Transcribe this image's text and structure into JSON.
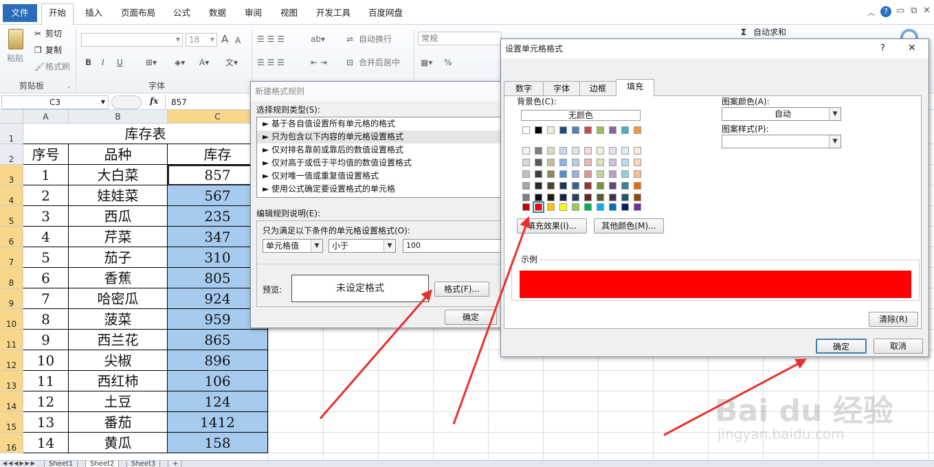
{
  "ribbon": {
    "tabs": [
      "文件",
      "开始",
      "插入",
      "页面布局",
      "公式",
      "数据",
      "审阅",
      "视图",
      "开发工具",
      "百度网盘"
    ],
    "clipboard": {
      "paste": "粘贴",
      "cut": "剪切",
      "copy": "复制",
      "format_painter": "格式刷",
      "group": "剪贴板"
    },
    "font": {
      "size": "18",
      "group": "字体",
      "grow": "A",
      "shrink": "A",
      "bold": "B",
      "italic": "I",
      "underline": "U"
    },
    "alignment": {
      "wrap": "自动换行",
      "merge": "合并后居中"
    },
    "number": {
      "format": "常规",
      "percent": "%"
    },
    "editing": {
      "autosum": "自动求和"
    }
  },
  "formula_bar": {
    "cell_ref": "C3",
    "fx": "fx",
    "value": "857"
  },
  "grid": {
    "columns": [
      "A",
      "B",
      "C"
    ],
    "title": "库存表",
    "headers": [
      "序号",
      "品种",
      "库存"
    ],
    "rows": [
      [
        "1",
        "大白菜",
        "857"
      ],
      [
        "2",
        "娃娃菜",
        "567"
      ],
      [
        "3",
        "西瓜",
        "235"
      ],
      [
        "4",
        "芹菜",
        "347"
      ],
      [
        "5",
        "茄子",
        "310"
      ],
      [
        "6",
        "香蕉",
        "805"
      ],
      [
        "7",
        "哈密瓜",
        "924"
      ],
      [
        "8",
        "菠菜",
        "959"
      ],
      [
        "9",
        "西兰花",
        "865"
      ],
      [
        "10",
        "尖椒",
        "896"
      ],
      [
        "11",
        "西红柿",
        "106"
      ],
      [
        "12",
        "土豆",
        "124"
      ],
      [
        "13",
        "番茄",
        "1412"
      ],
      [
        "14",
        "黄瓜",
        "158"
      ]
    ],
    "row_numbers": [
      "1",
      "2",
      "3",
      "4",
      "5",
      "6",
      "7",
      "8",
      "9",
      "10",
      "11",
      "12",
      "13",
      "14",
      "15",
      "16"
    ],
    "highlight_color": "#a6cbee"
  },
  "sheets": [
    "Sheet1",
    "Sheet2",
    "Sheet3"
  ],
  "rule_dialog": {
    "title": "新建格式规则",
    "select_type_label": "选择规则类型(S):",
    "rule_types": [
      "基于各自值设置所有单元格的格式",
      "只为包含以下内容的单元格设置格式",
      "仅对排名靠前或靠后的数值设置格式",
      "仅对高于或低于平均值的数值设置格式",
      "仅对唯一值或重复值设置格式",
      "使用公式确定要设置格式的单元格"
    ],
    "edit_label": "编辑规则说明(E):",
    "condition_label": "只为满足以下条件的单元格设置格式(O):",
    "cond_field": "单元格值",
    "cond_op": "小于",
    "cond_value": "100",
    "preview_label": "预览:",
    "preview_text": "未设定格式",
    "format_button": "格式(F)...",
    "ok_button": "确定"
  },
  "format_dialog": {
    "title": "设置单元格格式",
    "help": "?",
    "close": "✕",
    "tabs": [
      "数字",
      "字体",
      "边框",
      "填充"
    ],
    "bg_label": "背景色(C):",
    "no_color": "无颜色",
    "pattern_color_label": "图案颜色(A):",
    "pattern_color_value": "自动",
    "pattern_style_label": "图案样式(P):",
    "fill_effects": "填充效果(I)...",
    "more_colors": "其他颜色(M)...",
    "sample_label": "示例",
    "sample_color": "#ff0000",
    "clear": "清除(R)",
    "ok": "确定",
    "cancel": "取消",
    "theme_row": [
      "#ffffff",
      "#000000",
      "#eeece1",
      "#1f497d",
      "#4f81bd",
      "#c0504d",
      "#9bbb59",
      "#8064a2",
      "#4bacc6",
      "#f79646"
    ],
    "tints": [
      [
        "#f2f2f2",
        "#7f7f7f",
        "#ddd9c3",
        "#c6d9f0",
        "#dbe5f1",
        "#f2dcdb",
        "#ebf1dd",
        "#e5e0ec",
        "#dbeef3",
        "#fdeada"
      ],
      [
        "#d8d8d8",
        "#595959",
        "#c4bd97",
        "#8db3e2",
        "#b8cce4",
        "#e5b9b7",
        "#d7e3bc",
        "#ccc1d9",
        "#b7dde8",
        "#fbd5b5"
      ],
      [
        "#bfbfbf",
        "#3f3f3f",
        "#938953",
        "#548dd4",
        "#95b3d7",
        "#d99694",
        "#c3d69b",
        "#b2a2c7",
        "#92cddc",
        "#fac08f"
      ],
      [
        "#a5a5a5",
        "#262626",
        "#494429",
        "#17365d",
        "#366092",
        "#953734",
        "#76923c",
        "#5f497a",
        "#31859b",
        "#e36c09"
      ],
      [
        "#7f7f7f",
        "#0c0c0c",
        "#1d1b10",
        "#0f243e",
        "#244061",
        "#632423",
        "#4f6128",
        "#3f3151",
        "#205867",
        "#974806"
      ]
    ],
    "standard": [
      "#c00000",
      "#ff0000",
      "#ffc000",
      "#ffff00",
      "#92d050",
      "#00b050",
      "#00b0f0",
      "#0070c0",
      "#002060",
      "#7030a0"
    ],
    "selected_standard_index": 1
  },
  "watermark": {
    "brand": "Bai du 经验",
    "url": "jingyan.baidu.com"
  }
}
